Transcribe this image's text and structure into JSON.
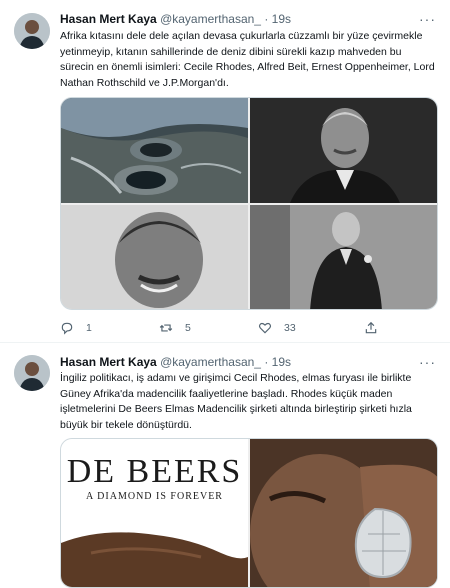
{
  "tweets": [
    {
      "author_name": "Hasan Mert Kaya",
      "author_handle": "@kayamerthasan_",
      "separator": "·",
      "time": "19s",
      "more_label": "···",
      "text": "Afrika kıtasını dele dele açılan devasa çukurlarla cüzzamlı bir yüze çevirmekle yetinmeyip, kıtanın sahillerinde de deniz dibini sürekli kazıp mahveden bu sürecin en önemli isimleri: Cecile Rhodes, Alfred Beit, Ernest Oppenheimer, Lord Nathan Rothschild ve J.P.Morgan'dı.",
      "reply_count": "1",
      "retweet_count": "5",
      "like_count": "33",
      "icons": [
        "reply-icon",
        "retweet-icon",
        "like-icon",
        "share-icon"
      ]
    },
    {
      "author_name": "Hasan Mert Kaya",
      "author_handle": "@kayamerthasan_",
      "separator": "·",
      "time": "19s",
      "more_label": "···",
      "text": "İngiliz politikacı, iş adamı ve girişimci Cecil Rhodes, elmas furyası ile birlikte Güney Afrika'da madencilik faaliyetlerine başladı. Rhodes küçük maden işletmelerini De Beers Elmas Madencilik şirketi altında birleştirip şirketi hızla büyük bir tekele dönüştürdü.",
      "ad_brand": "DE BEERS",
      "ad_slogan": "A DIAMOND IS FOREVER"
    }
  ]
}
